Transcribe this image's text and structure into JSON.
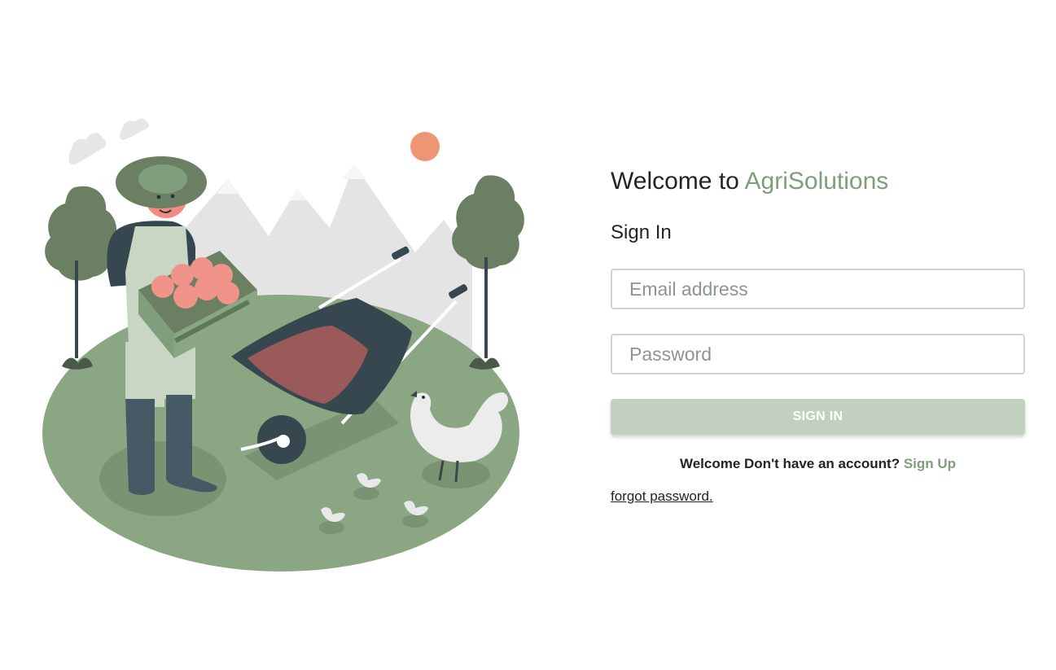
{
  "hero": {
    "illustration_icon": "farmer-illustration"
  },
  "login": {
    "welcome_prefix": "Welcome to ",
    "brand_name": "AgriSolutions",
    "title": "Sign In",
    "email_placeholder": "Email address",
    "password_placeholder": "Password",
    "submit_label": "SIGN IN",
    "signup_prompt": "Welcome Don't have an account? ",
    "signup_link": "Sign Up",
    "forgot_link": "forgot password."
  },
  "colors": {
    "brand": "#7f9f7c",
    "button_bg": "#c2d1bf",
    "ground": "#8aa683",
    "sun": "#ee9673"
  }
}
